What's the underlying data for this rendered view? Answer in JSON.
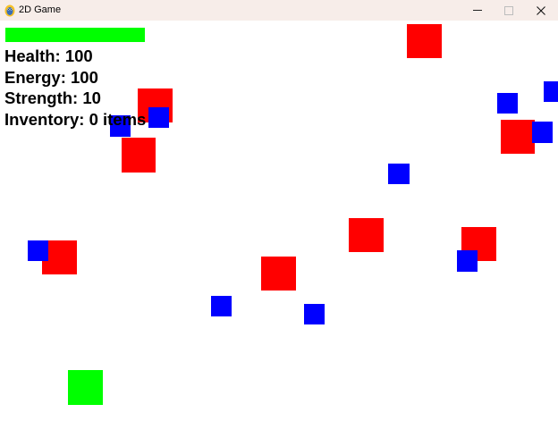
{
  "window": {
    "title": "2D Game"
  },
  "hud": {
    "health_label": "Health: 100",
    "energy_label": "Energy: 100",
    "strength_label": "Strength: 10",
    "inventory_label": "Inventory: 0 items",
    "health_fraction": 1.0
  },
  "colors": {
    "enemy": "#ff0000",
    "item": "#0000ff",
    "player": "#00ff00",
    "health_bar": "#00ff00",
    "titlebar": "#f7ede9"
  },
  "icons": {
    "app": "pygame-snake-icon",
    "minimize": "minimize-icon",
    "maximize": "maximize-icon",
    "close": "close-icon"
  }
}
